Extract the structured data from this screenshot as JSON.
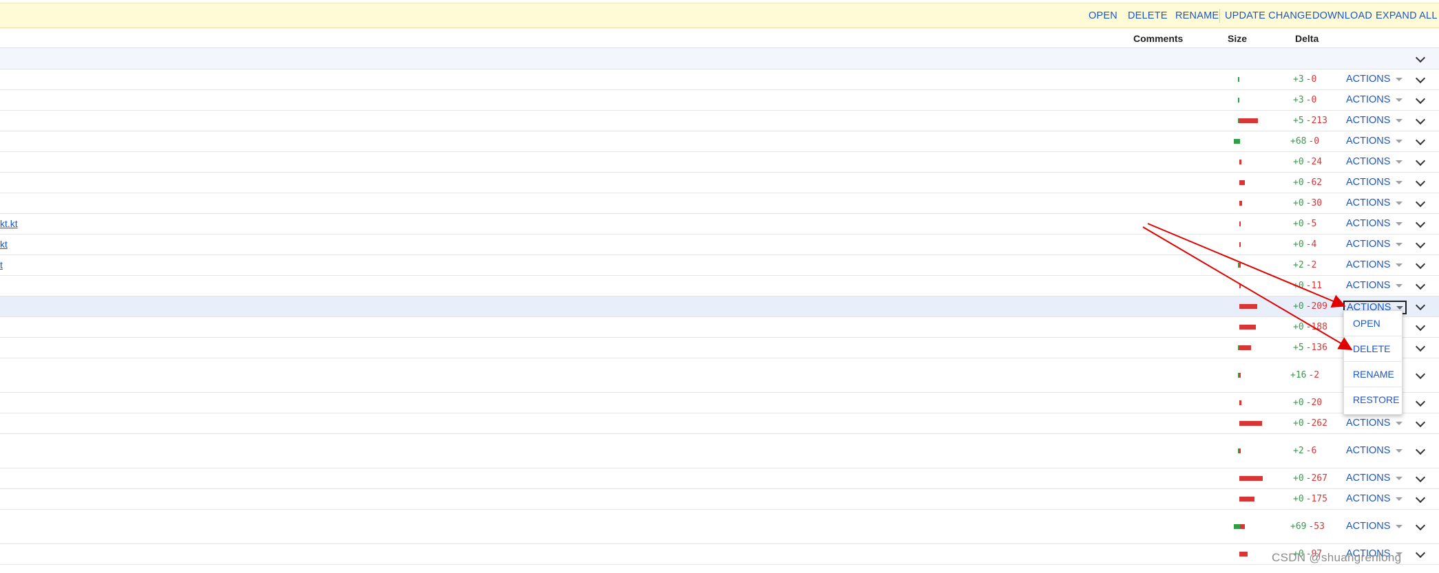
{
  "toolbar": {
    "open": "OPEN",
    "delete": "DELETE",
    "rename": "RENAME",
    "update_change": "UPDATE CHANGE",
    "download": "DOWNLOAD",
    "expand_all": "EXPAND ALL"
  },
  "columns": {
    "comments": "Comments",
    "size": "Size",
    "delta": "Delta"
  },
  "actions_label": "ACTIONS",
  "rows": [
    {
      "name": "",
      "plus": "+3",
      "minus": "-0",
      "added": 3,
      "removed": 0
    },
    {
      "name": "",
      "plus": "+3",
      "minus": "-0",
      "added": 3,
      "removed": 0
    },
    {
      "name": "",
      "plus": "+5",
      "minus": "-213",
      "added": 5,
      "removed": 213
    },
    {
      "name": "",
      "plus": "+68",
      "minus": "-0",
      "added": 68,
      "removed": 0
    },
    {
      "name": "",
      "plus": "+0",
      "minus": "-24",
      "added": 0,
      "removed": 24
    },
    {
      "name": "",
      "plus": "+0",
      "minus": "-62",
      "added": 0,
      "removed": 62
    },
    {
      "name": "",
      "plus": "+0",
      "minus": "-30",
      "added": 0,
      "removed": 30
    },
    {
      "name": "kt.kt",
      "plus": "+0",
      "minus": "-5",
      "added": 0,
      "removed": 5
    },
    {
      "name": "kt",
      "plus": "+0",
      "minus": "-4",
      "added": 0,
      "removed": 4
    },
    {
      "name": "t",
      "plus": "+2",
      "minus": "-2",
      "added": 2,
      "removed": 2
    },
    {
      "name": "",
      "plus": "+0",
      "minus": "-11",
      "added": 0,
      "removed": 11
    },
    {
      "name": "",
      "plus": "+0",
      "minus": "-209",
      "added": 0,
      "removed": 209
    },
    {
      "name": "",
      "plus": "+0",
      "minus": "-188",
      "added": 0,
      "removed": 188
    },
    {
      "name": "",
      "plus": "+5",
      "minus": "-136",
      "added": 5,
      "removed": 136
    },
    {
      "name": "",
      "plus": "+16",
      "minus": "-2",
      "added": 16,
      "removed": 2
    },
    {
      "name": "",
      "plus": "+0",
      "minus": "-20",
      "added": 0,
      "removed": 20
    },
    {
      "name": "",
      "plus": "+0",
      "minus": "-262",
      "added": 0,
      "removed": 262
    },
    {
      "name": "",
      "plus": "+2",
      "minus": "-6",
      "added": 2,
      "removed": 6
    },
    {
      "name": "",
      "plus": "+0",
      "minus": "-267",
      "added": 0,
      "removed": 267
    },
    {
      "name": "",
      "plus": "+0",
      "minus": "-175",
      "added": 0,
      "removed": 175
    },
    {
      "name": "",
      "plus": "+69",
      "minus": "-53",
      "added": 69,
      "removed": 53
    },
    {
      "name": "",
      "plus": "+0",
      "minus": "-97",
      "added": 0,
      "removed": 97
    }
  ],
  "dropdown": {
    "items": [
      "OPEN",
      "DELETE",
      "RENAME",
      "RESTORE"
    ]
  },
  "watermark": "CSDN @shuangrenlong",
  "colors": {
    "accent": "#1a56c7",
    "added": "#2f9e44",
    "removed": "#d93535",
    "toolbar_bg": "#fffbd6",
    "annotation_arrow": "#e00000"
  }
}
